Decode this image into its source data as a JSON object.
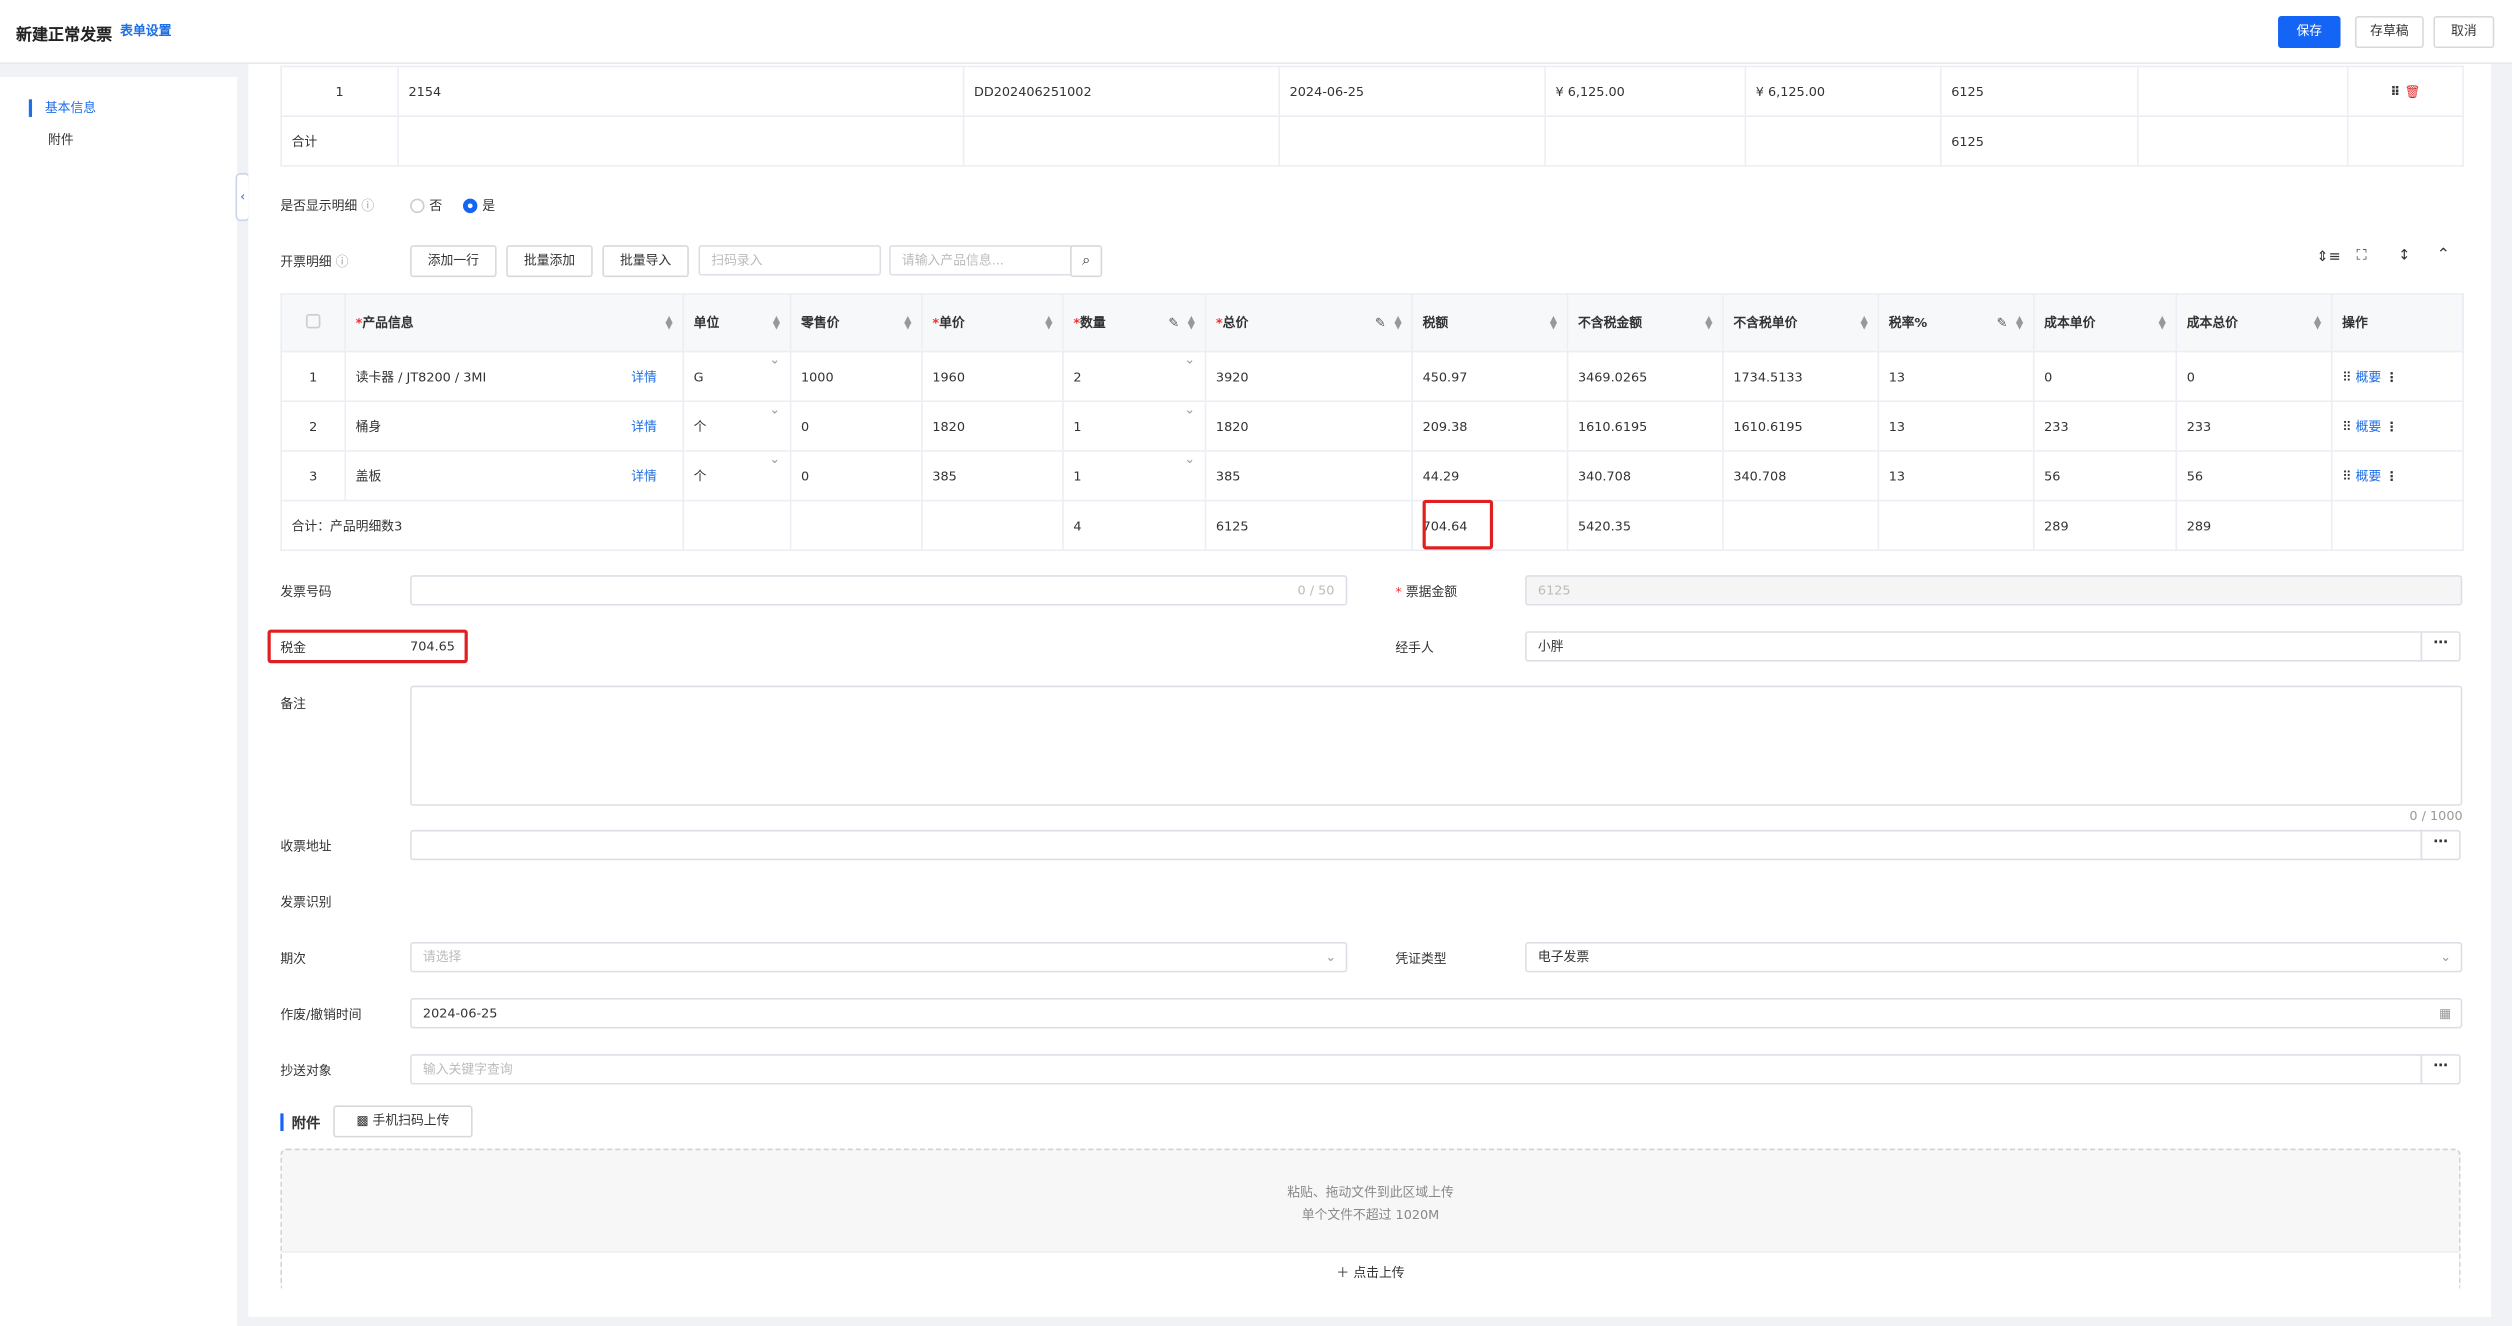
{
  "header": {
    "title": "新建正常发票",
    "settings_link": "表单设置",
    "save": "保存",
    "draft": "存草稿",
    "cancel": "取消"
  },
  "sidenav": {
    "items": [
      "基本信息",
      "附件"
    ]
  },
  "source_table": {
    "rows": [
      {
        "no": "1",
        "code": "2154",
        "order": "DD202406251002",
        "date": "2024-06-25",
        "amount1": "¥ 6,125.00",
        "amount2": "¥ 6,125.00",
        "total": "6125"
      }
    ],
    "sum_label": "合计",
    "sum_total": "6125"
  },
  "show_detail": {
    "label": "是否显示明细",
    "no": "否",
    "yes": "是"
  },
  "detail_toolbar": {
    "label": "开票明细",
    "add_row": "添加一行",
    "batch_add": "批量添加",
    "batch_import": "批量导入",
    "scan_placeholder": "扫码录入",
    "product_placeholder": "请输入产品信息..."
  },
  "detail_table": {
    "headers": [
      "产品信息",
      "单位",
      "零售价",
      "单价",
      "数量",
      "总价",
      "税额",
      "不含税金额",
      "不含税单价",
      "税率%",
      "成本单价",
      "成本总价",
      "操作"
    ],
    "detail_link": "详情",
    "summary_link": "概要",
    "rows": [
      {
        "no": "1",
        "product": "读卡器 / JT8200 / 3MI",
        "unit": "G",
        "retail": "1000",
        "price": "1960",
        "qty": "2",
        "total": "3920",
        "tax": "450.97",
        "ex_amount": "3469.0265",
        "ex_price": "1734.5133",
        "rate": "13",
        "cost_price": "0",
        "cost_total": "0"
      },
      {
        "no": "2",
        "product": "桶身",
        "unit": "个",
        "retail": "0",
        "price": "1820",
        "qty": "1",
        "total": "1820",
        "tax": "209.38",
        "ex_amount": "1610.6195",
        "ex_price": "1610.6195",
        "rate": "13",
        "cost_price": "233",
        "cost_total": "233"
      },
      {
        "no": "3",
        "product": "盖板",
        "unit": "个",
        "retail": "0",
        "price": "385",
        "qty": "1",
        "total": "385",
        "tax": "44.29",
        "ex_amount": "340.708",
        "ex_price": "340.708",
        "rate": "13",
        "cost_price": "56",
        "cost_total": "56"
      }
    ],
    "summary": {
      "label": "合计：产品明细数3",
      "qty": "4",
      "total": "6125",
      "tax": "704.64",
      "ex_amount": "5420.35",
      "cost_price": "289",
      "cost_total": "289"
    }
  },
  "form": {
    "invoice_no_label": "发票号码",
    "invoice_no_count": "0 / 50",
    "bill_amount_label": "票据金额",
    "bill_amount": "6125",
    "tax_label": "税金",
    "tax_value": "704.65",
    "handler_label": "经手人",
    "handler": "小胖",
    "remark_label": "备注",
    "remark_count": "0 / 1000",
    "address_label": "收票地址",
    "recognize_label": "发票识别",
    "period_label": "期次",
    "period_placeholder": "请选择",
    "voucher_label": "凭证类型",
    "voucher": "电子发票",
    "void_time_label": "作废/撤销时间",
    "void_time": "2024-06-25",
    "cc_label": "抄送对象",
    "cc_placeholder": "输入关键字查询"
  },
  "attachment": {
    "title": "附件",
    "scan_upload": "手机扫码上传",
    "hint1": "粘贴、拖动文件到此区域上传",
    "hint2": "单个文件不超过 1020M",
    "upload_button": "点击上传"
  }
}
